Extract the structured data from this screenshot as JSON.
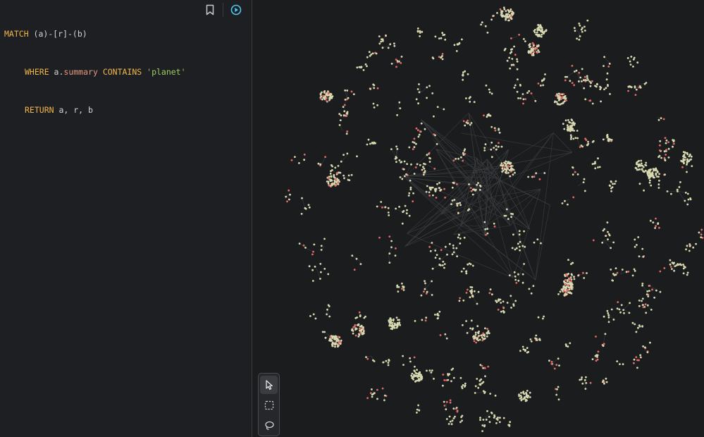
{
  "editor": {
    "query_lines": [
      [
        {
          "t": "MATCH",
          "c": "kw"
        },
        {
          "t": " (a)-[r]-(b)",
          "c": "plain"
        }
      ],
      [
        {
          "t": "WHERE",
          "c": "kw"
        },
        {
          "t": " a.",
          "c": "plain"
        },
        {
          "t": "summary",
          "c": "prop"
        },
        {
          "t": " ",
          "c": "plain"
        },
        {
          "t": "CONTAINS",
          "c": "kw"
        },
        {
          "t": " ",
          "c": "plain"
        },
        {
          "t": "'planet'",
          "c": "str"
        }
      ],
      [
        {
          "t": "RETURN",
          "c": "kw"
        },
        {
          "t": " a, r, b",
          "c": "plain"
        }
      ]
    ],
    "bookmark_icon": "bookmark-icon",
    "run_icon": "play-circle-icon"
  },
  "graph": {
    "node_colors": {
      "primary": "#d8d9b0",
      "secondary": "#e26a6a"
    },
    "edge_color": "#3c3d40"
  },
  "toolbar": {
    "tools": [
      {
        "name": "pointer-select-tool",
        "icon": "cursor-arrow-icon",
        "active": true
      },
      {
        "name": "box-select-tool",
        "icon": "dashed-rectangle-icon",
        "active": false
      },
      {
        "name": "lasso-select-tool",
        "icon": "lasso-icon",
        "active": false
      }
    ]
  },
  "colors": {
    "keyword": "#f0b64e",
    "property": "#e59a7d",
    "string": "#9ccc65",
    "accent": "#4ec9f0"
  }
}
